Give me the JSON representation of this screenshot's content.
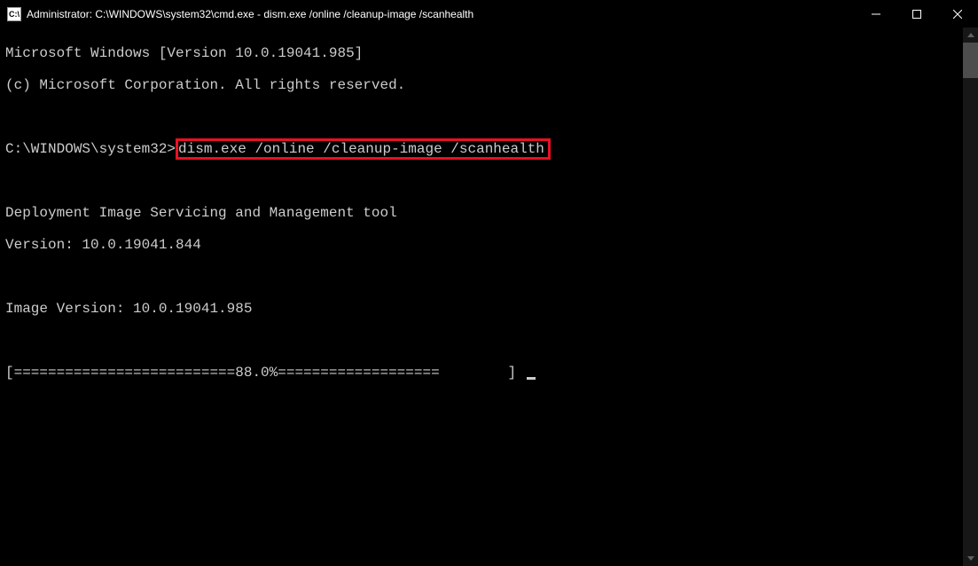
{
  "titlebar": {
    "icon_label": "C:\\",
    "title": "Administrator: C:\\WINDOWS\\system32\\cmd.exe - dism.exe  /online /cleanup-image /scanhealth"
  },
  "console": {
    "line1": "Microsoft Windows [Version 10.0.19041.985]",
    "line2": "(c) Microsoft Corporation. All rights reserved.",
    "blank1": "",
    "prompt_prefix": "C:\\WINDOWS\\system32>",
    "prompt_command": "dism.exe /online /cleanup-image /scanhealth",
    "blank2": "",
    "line5": "Deployment Image Servicing and Management tool",
    "line6": "Version: 10.0.19041.844",
    "blank3": "",
    "line8": "Image Version: 10.0.19041.985",
    "blank4": "",
    "progress": "[==========================88.0%===================        ] "
  }
}
